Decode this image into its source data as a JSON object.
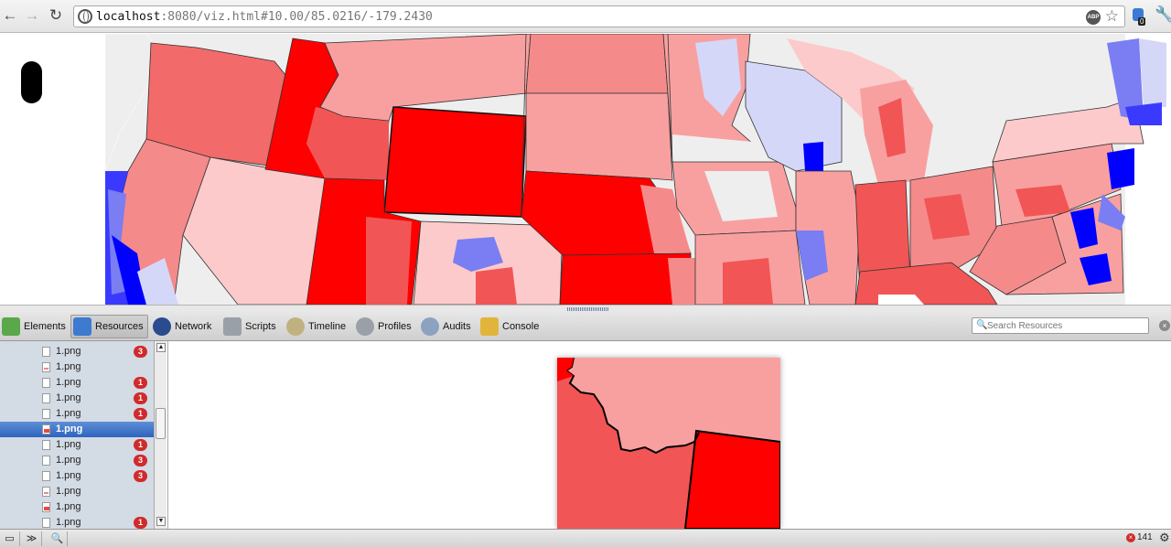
{
  "browser": {
    "url_host": "localhost",
    "url_rest": ":8080/viz.html#10.00/85.0216/-179.2430",
    "abp_label": "ABP",
    "extension_badge": "0"
  },
  "devtools": {
    "tabs": [
      {
        "label": "Elements",
        "icon": "elements-icon",
        "color": "#5aa84a"
      },
      {
        "label": "Resources",
        "icon": "resources-icon",
        "color": "#3d7ad0"
      },
      {
        "label": "Network",
        "icon": "network-icon",
        "color": "#2a4b8d"
      },
      {
        "label": "Scripts",
        "icon": "scripts-icon",
        "color": "#9aa0a8"
      },
      {
        "label": "Timeline",
        "icon": "timeline-icon",
        "color": "#c0b280"
      },
      {
        "label": "Profiles",
        "icon": "profiles-icon",
        "color": "#9aa0a8"
      },
      {
        "label": "Audits",
        "icon": "audits-icon",
        "color": "#8ba2c0"
      },
      {
        "label": "Console",
        "icon": "console-icon",
        "color": "#e0b53a"
      }
    ],
    "active_tab": "Resources",
    "search_placeholder": "Search Resources",
    "resources": [
      {
        "name": "1.png",
        "badge": "3",
        "icon": "blank"
      },
      {
        "name": "1.png",
        "badge": "",
        "icon": "small"
      },
      {
        "name": "1.png",
        "badge": "1",
        "icon": "blank"
      },
      {
        "name": "1.png",
        "badge": "1",
        "icon": "blank"
      },
      {
        "name": "1.png",
        "badge": "1",
        "icon": "blank"
      },
      {
        "name": "1.png",
        "badge": "",
        "icon": "img",
        "selected": true
      },
      {
        "name": "1.png",
        "badge": "1",
        "icon": "blank"
      },
      {
        "name": "1.png",
        "badge": "3",
        "icon": "blank"
      },
      {
        "name": "1.png",
        "badge": "3",
        "icon": "blank"
      },
      {
        "name": "1.png",
        "badge": "",
        "icon": "small"
      },
      {
        "name": "1.png",
        "badge": "",
        "icon": "img"
      },
      {
        "name": "1.png",
        "badge": "1",
        "icon": "blank"
      }
    ],
    "error_count": "141"
  },
  "colors": {
    "strong_red": "#ff0000",
    "red": "#f25555",
    "light_red": "#f8a0a0",
    "pale_red": "#fccaca",
    "neutral": "#eeeeee",
    "pale_blue": "#d5d7f8",
    "blue": "#7a7ef2",
    "strong_blue": "#0000ff"
  }
}
